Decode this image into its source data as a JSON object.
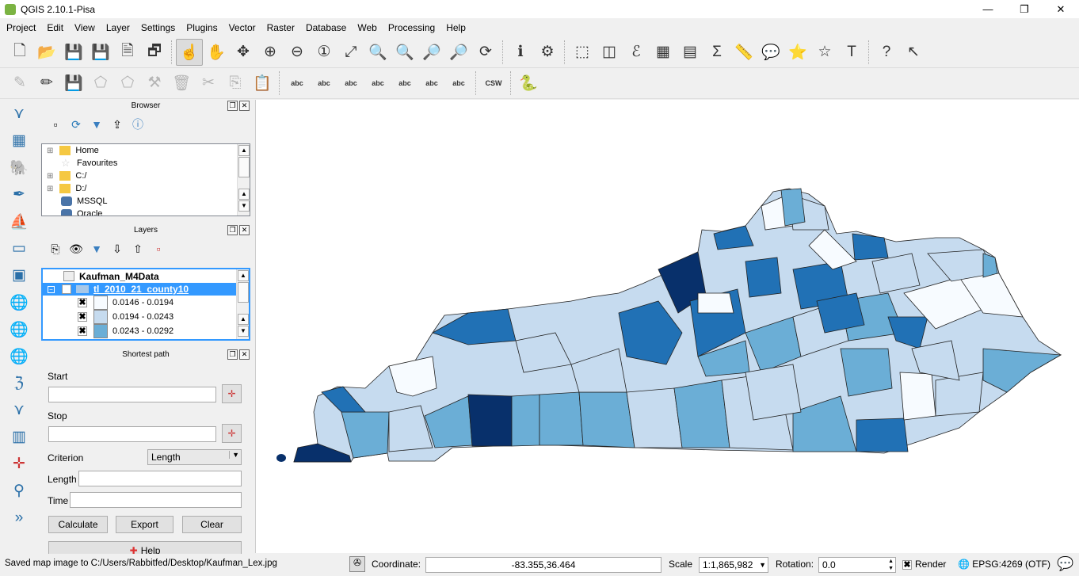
{
  "window": {
    "title": "QGIS 2.10.1-Pisa",
    "minimize": "—",
    "maximize": "❐",
    "close": "✕"
  },
  "menu": [
    "Project",
    "Edit",
    "View",
    "Layer",
    "Settings",
    "Plugins",
    "Vector",
    "Raster",
    "Database",
    "Web",
    "Processing",
    "Help"
  ],
  "toolbar1": [
    {
      "name": "new-project-icon",
      "g": "🗋"
    },
    {
      "name": "open-project-icon",
      "g": "📂"
    },
    {
      "name": "save-project-icon",
      "g": "💾"
    },
    {
      "name": "save-as-icon",
      "g": "💾"
    },
    {
      "name": "new-print-composer-icon",
      "g": "🗎"
    },
    {
      "name": "composer-manager-icon",
      "g": "🗗"
    },
    {
      "sep": true
    },
    {
      "name": "touch-zoom-pan-icon",
      "g": "☝",
      "active": true
    },
    {
      "name": "pan-map-icon",
      "g": "✋"
    },
    {
      "name": "pan-to-selection-icon",
      "g": "✥"
    },
    {
      "name": "zoom-in-icon",
      "g": "⊕"
    },
    {
      "name": "zoom-out-icon",
      "g": "⊖"
    },
    {
      "name": "zoom-native-icon",
      "g": "①"
    },
    {
      "name": "zoom-full-icon",
      "g": "⤢"
    },
    {
      "name": "zoom-to-selection-icon",
      "g": "🔍"
    },
    {
      "name": "zoom-to-layer-icon",
      "g": "🔍"
    },
    {
      "name": "zoom-last-icon",
      "g": "🔎"
    },
    {
      "name": "zoom-next-icon",
      "g": "🔎"
    },
    {
      "name": "refresh-icon",
      "g": "⟳"
    },
    {
      "sep": true
    },
    {
      "name": "identify-icon",
      "g": "ℹ"
    },
    {
      "name": "map-tips-icon",
      "g": "⚙"
    },
    {
      "sep": true
    },
    {
      "name": "select-features-icon",
      "g": "⬚"
    },
    {
      "name": "deselect-icon",
      "g": "◫"
    },
    {
      "name": "select-by-expression-icon",
      "g": "ℰ"
    },
    {
      "name": "attribute-table-icon",
      "g": "▦"
    },
    {
      "name": "field-calculator-icon",
      "g": "▤"
    },
    {
      "name": "statistics-icon",
      "g": "Σ"
    },
    {
      "name": "measure-icon",
      "g": "📏"
    },
    {
      "name": "annotation-icon",
      "g": "💬"
    },
    {
      "name": "new-bookmark-icon",
      "g": "⭐"
    },
    {
      "name": "show-bookmarks-icon",
      "g": "☆"
    },
    {
      "name": "text-annotation-icon",
      "g": "T"
    },
    {
      "sep": true
    },
    {
      "name": "help-icon",
      "g": "?"
    },
    {
      "name": "whats-this-icon",
      "g": "↖"
    }
  ],
  "toolbar2": [
    {
      "name": "current-edits-icon",
      "g": "✎"
    },
    {
      "name": "toggle-editing-icon",
      "g": "✏"
    },
    {
      "name": "save-edits-icon",
      "g": "💾"
    },
    {
      "name": "add-feature-icon",
      "g": "⬠"
    },
    {
      "name": "move-feature-icon",
      "g": "⬠"
    },
    {
      "name": "node-tool-icon",
      "g": "⚒"
    },
    {
      "name": "delete-selected-icon",
      "g": "🗑"
    },
    {
      "name": "cut-features-icon",
      "g": "✂"
    },
    {
      "name": "copy-features-icon",
      "g": "⎘"
    },
    {
      "name": "paste-features-icon",
      "g": "📋"
    },
    {
      "sep": true
    },
    {
      "name": "label-icon",
      "g": "abc"
    },
    {
      "name": "layer-labeling-icon",
      "g": "abc"
    },
    {
      "name": "pin-labels-icon",
      "g": "abc"
    },
    {
      "name": "show-hide-labels-icon",
      "g": "abc"
    },
    {
      "name": "move-label-icon",
      "g": "abc"
    },
    {
      "name": "rotate-label-icon",
      "g": "abc"
    },
    {
      "name": "change-label-icon",
      "g": "abc"
    },
    {
      "sep": true
    },
    {
      "name": "csw-icon",
      "g": "CSW"
    },
    {
      "sep": true
    },
    {
      "name": "python-console-icon",
      "g": "🐍"
    }
  ],
  "left_toolbar": [
    "add-vector-layer-icon",
    "add-raster-layer-icon",
    "add-postgis-layer-icon",
    "add-spatialite-layer-icon",
    "add-mssql-layer-icon",
    "add-oracle-layer-icon",
    "add-db2-layer-icon",
    "add-wms-layer-icon",
    "add-wcs-layer-icon",
    "add-wfs-layer-icon",
    "add-delimited-text-icon",
    "new-shapefile-icon",
    "new-spatialite-icon",
    "add-crosshair-icon",
    "add-gps-icon",
    "more-icon"
  ],
  "browser": {
    "title": "Browser",
    "items": [
      {
        "label": "Home",
        "icon": "folder"
      },
      {
        "label": "Favourites",
        "icon": "star"
      },
      {
        "label": "C:/",
        "icon": "folder"
      },
      {
        "label": "D:/",
        "icon": "folder"
      },
      {
        "label": "MSSQL",
        "icon": "db"
      },
      {
        "label": "Oracle",
        "icon": "db"
      }
    ]
  },
  "layers": {
    "title": "Layers",
    "group": "Kaufman_M4Data",
    "layer": "tl_2010_21_county10",
    "classes": [
      {
        "label": "0.0146 - 0.0194",
        "color": "#f7fbff"
      },
      {
        "label": "0.0194 - 0.0243",
        "color": "#c6dbef"
      },
      {
        "label": "0.0243 - 0.0292",
        "color": "#6baed6"
      }
    ]
  },
  "shortest_path": {
    "title": "Shortest path",
    "start_label": "Start",
    "start_value": "",
    "stop_label": "Stop",
    "stop_value": "",
    "criterion_label": "Criterion",
    "criterion_value": "Length",
    "length_label": "Length",
    "length_value": "",
    "time_label": "Time",
    "time_value": "",
    "calculate": "Calculate",
    "export": "Export",
    "clear": "Clear",
    "help": "Help"
  },
  "status": {
    "message": "Saved map image to C:/Users/Rabbitfed/Desktop/Kaufman_Lex.jpg",
    "coordinate_label": "Coordinate:",
    "coordinate": "-83.355,36.464",
    "scale_label": "Scale",
    "scale": "1:1,865,982",
    "rotation_label": "Rotation:",
    "rotation": "0.0",
    "render_label": "Render",
    "render_checked": true,
    "crs": "EPSG:4269 (OTF)"
  },
  "map": {
    "palette": [
      "#f7fbff",
      "#c6dbef",
      "#6baed6",
      "#2171b5",
      "#08306b"
    ]
  }
}
